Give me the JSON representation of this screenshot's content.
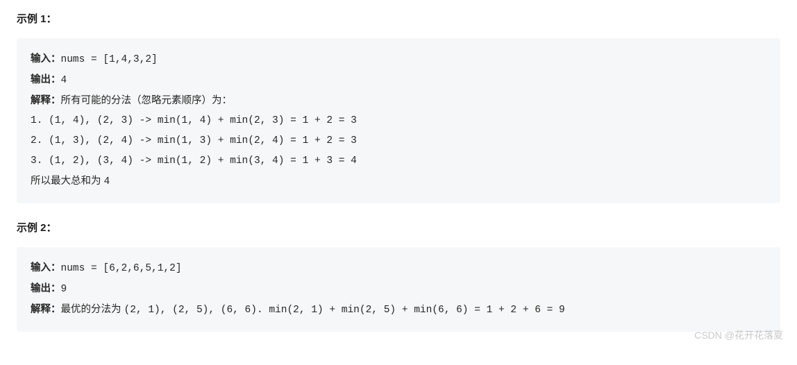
{
  "example1": {
    "heading": "示例 1：",
    "input_label": "输入：",
    "input_value": "nums = [1,4,3,2]",
    "output_label": "输出：",
    "output_value": "4",
    "explain_label": "解释：",
    "explain_intro": "所有可能的分法（忽略元素顺序）为：",
    "lines": [
      "1. (1, 4), (2, 3) -> min(1, 4) + min(2, 3) = 1 + 2 = 3",
      "2. (1, 3), (2, 4) -> min(1, 3) + min(2, 4) = 1 + 2 = 3",
      "3. (1, 2), (3, 4) -> min(1, 2) + min(3, 4) = 1 + 3 = 4"
    ],
    "conclusion_text": "所以最大总和为 ",
    "conclusion_value": "4"
  },
  "example2": {
    "heading": "示例 2：",
    "input_label": "输入：",
    "input_value": "nums = [6,2,6,5,1,2]",
    "output_label": "输出：",
    "output_value": "9",
    "explain_label": "解释：",
    "explain_text_a": "最优的分法为 ",
    "explain_text_b": "(2, 1), (2, 5), (6, 6). min(2, 1) + min(2, 5) + min(6, 6) = 1 + 2 + 6 = 9"
  },
  "watermark": "CSDN @花开花落夏"
}
